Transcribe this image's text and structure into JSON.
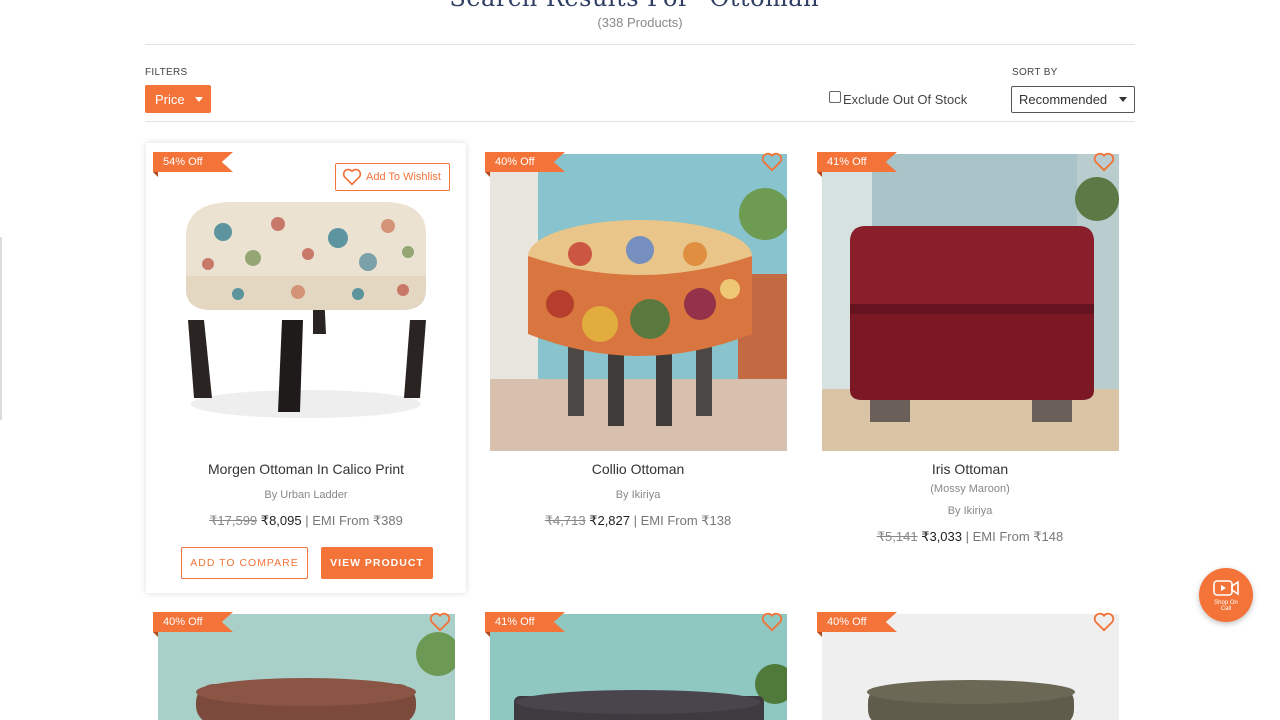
{
  "header": {
    "title": "Search Results For \"Ottoman\"",
    "count": "(338 Products)"
  },
  "filters": {
    "label": "FILTERS",
    "price_button": "Price",
    "exclude_label": "Exclude Out Of Stock",
    "exclude_checked": false
  },
  "sort": {
    "label": "SORT BY",
    "selected": "Recommended"
  },
  "products": [
    {
      "discount": "54% Off",
      "wishlist_label": "Add To Wishlist",
      "name": "Morgen Ottoman In Calico Print",
      "variant": "",
      "brand": "By Urban Ladder",
      "mrp": "₹17,599",
      "price": "₹8,095",
      "emi": "| EMI From ₹389",
      "compare_label": "ADD TO COMPARE",
      "view_label": "VIEW PRODUCT"
    },
    {
      "discount": "40% Off",
      "name": "Collio Ottoman",
      "variant": "",
      "brand": "By Ikiriya",
      "mrp": "₹4,713",
      "price": "₹2,827",
      "emi": "| EMI From ₹138"
    },
    {
      "discount": "41% Off",
      "name": "Iris Ottoman",
      "variant": "(Mossy Maroon)",
      "brand": "By Ikiriya",
      "mrp": "₹5,141",
      "price": "₹3,033",
      "emi": "| EMI From ₹148"
    },
    {
      "discount": "40% Off"
    },
    {
      "discount": "41% Off"
    },
    {
      "discount": "40% Off"
    }
  ],
  "shop_on_call": {
    "label": "Shop On Call",
    "icon": "video-camera-icon"
  },
  "colors": {
    "accent": "#f37339",
    "title": "#2f3e63"
  }
}
